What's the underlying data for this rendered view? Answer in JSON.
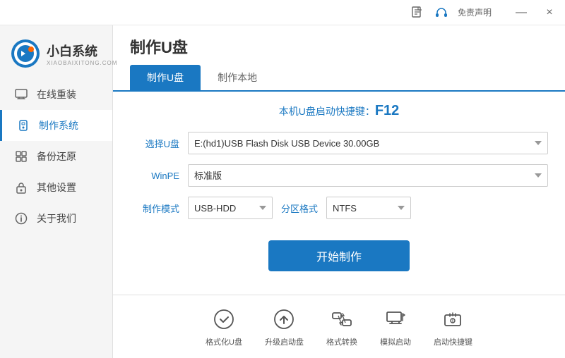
{
  "titlebar": {
    "free_decl": "免责声明",
    "min_btn": "—",
    "close_btn": "×"
  },
  "logo": {
    "name": "小白系统",
    "sub": "XIAOBAIXITONG.COM"
  },
  "sidebar": {
    "items": [
      {
        "id": "online-reinstall",
        "label": "在线重装",
        "icon": "monitor"
      },
      {
        "id": "make-system",
        "label": "制作系统",
        "icon": "usb",
        "active": true
      },
      {
        "id": "backup-restore",
        "label": "备份还原",
        "icon": "grid"
      },
      {
        "id": "other-settings",
        "label": "其他设置",
        "icon": "lock"
      },
      {
        "id": "about-us",
        "label": "关于我们",
        "icon": "info"
      }
    ]
  },
  "page": {
    "title": "制作U盘",
    "tabs": [
      {
        "id": "make-usb",
        "label": "制作U盘",
        "active": true
      },
      {
        "id": "make-local",
        "label": "制作本地",
        "active": false
      }
    ],
    "shortcut_hint_prefix": "本机U盘启动快捷键：",
    "shortcut_key": "F12",
    "form": {
      "select_usb_label": "选择U盘",
      "select_usb_value": "E:(hd1)USB Flash Disk USB Device 30.00GB",
      "winpe_label": "WinPE",
      "winpe_value": "标准版",
      "make_mode_label": "制作模式",
      "make_mode_value": "USB-HDD",
      "partition_label": "分区格式",
      "partition_value": "NTFS"
    },
    "start_btn": "开始制作"
  },
  "toolbar": {
    "items": [
      {
        "id": "format-usb",
        "label": "格式化U盘",
        "icon": "circle-check"
      },
      {
        "id": "upgrade-boot",
        "label": "升级启动盘",
        "icon": "circle-up"
      },
      {
        "id": "format-convert",
        "label": "格式转换",
        "icon": "convert"
      },
      {
        "id": "simulate-boot",
        "label": "模拟启动",
        "icon": "desktop"
      },
      {
        "id": "boot-shortcut",
        "label": "启动快捷键",
        "icon": "key"
      }
    ]
  }
}
